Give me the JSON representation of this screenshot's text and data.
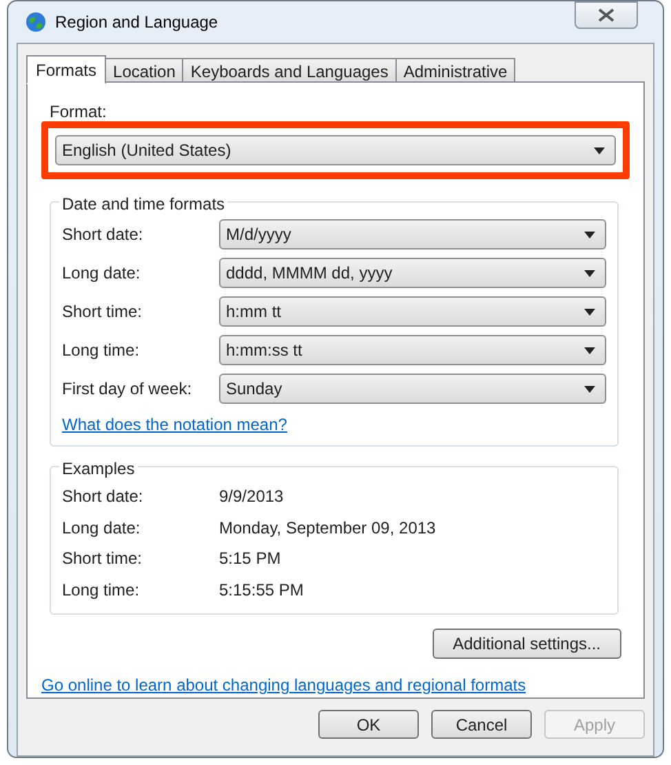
{
  "window": {
    "title": "Region and Language"
  },
  "tabs": [
    {
      "label": "Formats",
      "selected": true
    },
    {
      "label": "Location",
      "selected": false
    },
    {
      "label": "Keyboards and Languages",
      "selected": false
    },
    {
      "label": "Administrative",
      "selected": false
    }
  ],
  "format": {
    "label": "Format:",
    "value": "English (United States)",
    "highlighted": true
  },
  "date_time_formats": {
    "title": "Date and time formats",
    "rows": [
      {
        "label": "Short date:",
        "value": "M/d/yyyy"
      },
      {
        "label": "Long date:",
        "value": "dddd, MMMM dd, yyyy"
      },
      {
        "label": "Short time:",
        "value": "h:mm tt"
      },
      {
        "label": "Long time:",
        "value": "h:mm:ss tt"
      },
      {
        "label": "First day of week:",
        "value": "Sunday"
      }
    ],
    "link": "What does the notation mean?"
  },
  "examples": {
    "title": "Examples",
    "rows": [
      {
        "label": "Short date:",
        "value": "9/9/2013"
      },
      {
        "label": "Long date:",
        "value": "Monday, September 09, 2013"
      },
      {
        "label": "Short time:",
        "value": "5:15 PM"
      },
      {
        "label": "Long time:",
        "value": "5:15:55 PM"
      }
    ]
  },
  "additional_button": "Additional settings...",
  "online_link": "Go online to learn about changing languages and regional formats",
  "buttons": [
    {
      "label": "OK",
      "disabled": false
    },
    {
      "label": "Cancel",
      "disabled": false
    },
    {
      "label": "Apply",
      "disabled": true
    }
  ]
}
